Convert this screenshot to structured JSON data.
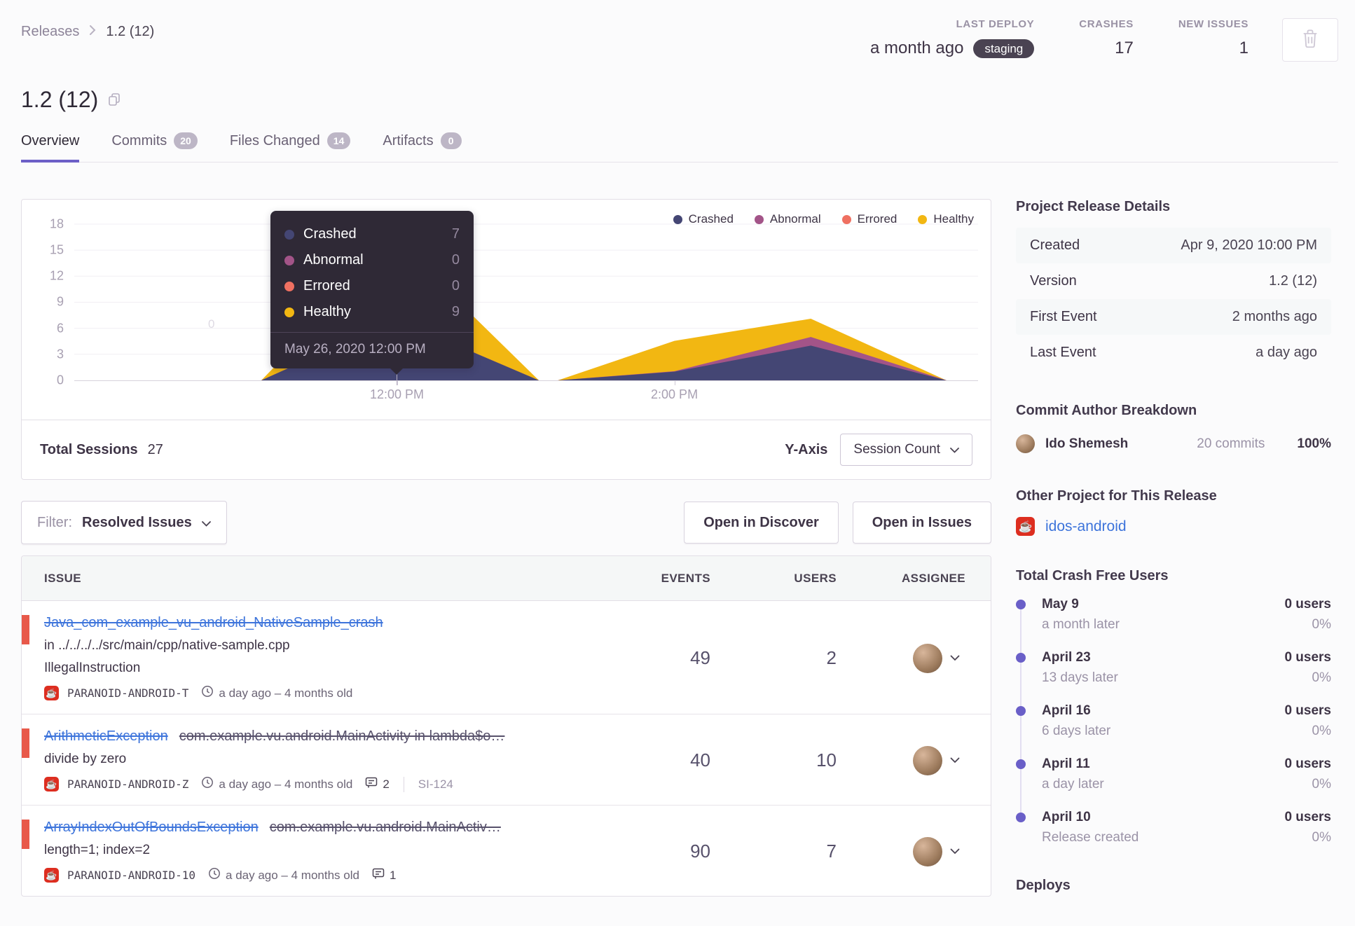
{
  "breadcrumb": {
    "parent": "Releases",
    "current": "1.2 (12)"
  },
  "header": {
    "title": "1.2 (12)",
    "stats": [
      {
        "label": "LAST DEPLOY",
        "value": "a month ago",
        "badge": "staging"
      },
      {
        "label": "CRASHES",
        "value": "17"
      },
      {
        "label": "NEW ISSUES",
        "value": "1"
      }
    ]
  },
  "tabs": [
    {
      "label": "Overview",
      "active": true
    },
    {
      "label": "Commits",
      "badge": "20"
    },
    {
      "label": "Files Changed",
      "badge": "14"
    },
    {
      "label": "Artifacts",
      "badge": "0"
    }
  ],
  "chart_card": {
    "total_sessions_label": "Total Sessions",
    "total_sessions_value": "27",
    "y_axis_label": "Y-Axis",
    "y_axis_selected": "Session Count"
  },
  "chart_data": {
    "type": "area",
    "stacked": true,
    "legend_position": "top-right",
    "ylim": [
      0,
      18
    ],
    "y_ticks": [
      0,
      3,
      6,
      9,
      12,
      15,
      18
    ],
    "x_ticks": [
      {
        "label": "12:00 PM",
        "fraction": 0.357
      },
      {
        "label": "2:00 PM",
        "fraction": 0.664
      }
    ],
    "x_fractions": [
      0,
      0.207,
      0.357,
      0.514,
      0.535,
      0.664,
      0.815,
      0.965
    ],
    "series": [
      {
        "name": "Crashed",
        "color": "#444674",
        "values": [
          0,
          0,
          7,
          0,
          0,
          1,
          4,
          0
        ]
      },
      {
        "name": "Abnormal",
        "color": "#a35488",
        "values": [
          0,
          0,
          0,
          0,
          0,
          0.05,
          1,
          0
        ]
      },
      {
        "name": "Errored",
        "color": "#ef7061",
        "values": [
          0,
          0,
          0,
          0,
          0,
          0,
          0,
          0
        ]
      },
      {
        "name": "Healthy",
        "color": "#f2b712",
        "values": [
          0,
          0,
          9,
          0,
          0,
          3.5,
          2.1,
          0
        ]
      }
    ],
    "ghost_label": "0",
    "tooltip": {
      "rows": [
        {
          "name": "Crashed",
          "color": "#444674",
          "value": "7"
        },
        {
          "name": "Abnormal",
          "color": "#a35488",
          "value": "0"
        },
        {
          "name": "Errored",
          "color": "#ef7061",
          "value": "0"
        },
        {
          "name": "Healthy",
          "color": "#f2b712",
          "value": "9"
        }
      ],
      "date": "May 26, 2020 12:00 PM"
    }
  },
  "issues_controls": {
    "filter_label": "Filter:",
    "filter_value": "Resolved Issues",
    "open_discover": "Open in Discover",
    "open_issues": "Open in Issues"
  },
  "issues_table": {
    "headers": [
      "ISSUE",
      "EVENTS",
      "USERS",
      "ASSIGNEE"
    ],
    "rows": [
      {
        "title": "Java_com_example_vu_android_NativeSample_crash",
        "culprit": "",
        "lines": [
          "in ../../../../src/main/cpp/native-sample.cpp",
          "IllegalInstruction"
        ],
        "project": "PARANOID-ANDROID-T",
        "age": "a day ago – 4 months old",
        "comments": "",
        "ref": "",
        "events": "49",
        "users": "2"
      },
      {
        "title": "ArithmeticException",
        "culprit": "com.example.vu.android.MainActivity in lambda$o…",
        "lines": [
          "divide by zero"
        ],
        "project": "PARANOID-ANDROID-Z",
        "age": "a day ago – 4 months old",
        "comments": "2",
        "ref": "SI-124",
        "events": "40",
        "users": "10"
      },
      {
        "title": "ArrayIndexOutOfBoundsException",
        "culprit": "com.example.vu.android.MainActiv…",
        "lines": [
          "length=1; index=2"
        ],
        "project": "PARANOID-ANDROID-10",
        "age": "a day ago – 4 months old",
        "comments": "1",
        "ref": "",
        "events": "90",
        "users": "7"
      }
    ]
  },
  "sidebar": {
    "release_details": {
      "heading": "Project Release Details",
      "rows": [
        {
          "label": "Created",
          "value": "Apr 9, 2020 10:00 PM"
        },
        {
          "label": "Version",
          "value": "1.2 (12)"
        },
        {
          "label": "First Event",
          "value": "2 months ago"
        },
        {
          "label": "Last Event",
          "value": "a day ago"
        }
      ]
    },
    "commit_authors": {
      "heading": "Commit Author Breakdown",
      "rows": [
        {
          "name": "Ido Shemesh",
          "commits": "20 commits",
          "percent": "100%"
        }
      ]
    },
    "other_project": {
      "heading": "Other Project for This Release",
      "project": "idos-android"
    },
    "crash_free": {
      "heading": "Total Crash Free Users",
      "items": [
        {
          "date": "May 9",
          "sub": "a month later",
          "users": "0 users",
          "percent": "0%"
        },
        {
          "date": "April 23",
          "sub": "13 days later",
          "users": "0 users",
          "percent": "0%"
        },
        {
          "date": "April 16",
          "sub": "6 days later",
          "users": "0 users",
          "percent": "0%"
        },
        {
          "date": "April 11",
          "sub": "a day later",
          "users": "0 users",
          "percent": "0%"
        },
        {
          "date": "April 10",
          "sub": "Release created",
          "users": "0 users",
          "percent": "0%"
        }
      ]
    },
    "deploys_heading": "Deploys"
  },
  "icons": {
    "trash-icon": "trash can outline",
    "copy-icon": "duplicate squares outline",
    "chevron-right-icon": "breadcrumb separator",
    "chevron-down-icon": "dropdown chevron",
    "clock-icon": "clock outline",
    "comment-icon": "speech bubble",
    "java-project-icon": "☕ coffee cup on red tile"
  },
  "colors": {
    "accent_purple": "#6c5fc7",
    "link_blue": "#3d74db",
    "issue_accent_red": "#e8594a",
    "project_badge_red": "#dd2e20",
    "staging_pill_bg": "#4a4352",
    "tooltip_bg": "#2f2936"
  }
}
